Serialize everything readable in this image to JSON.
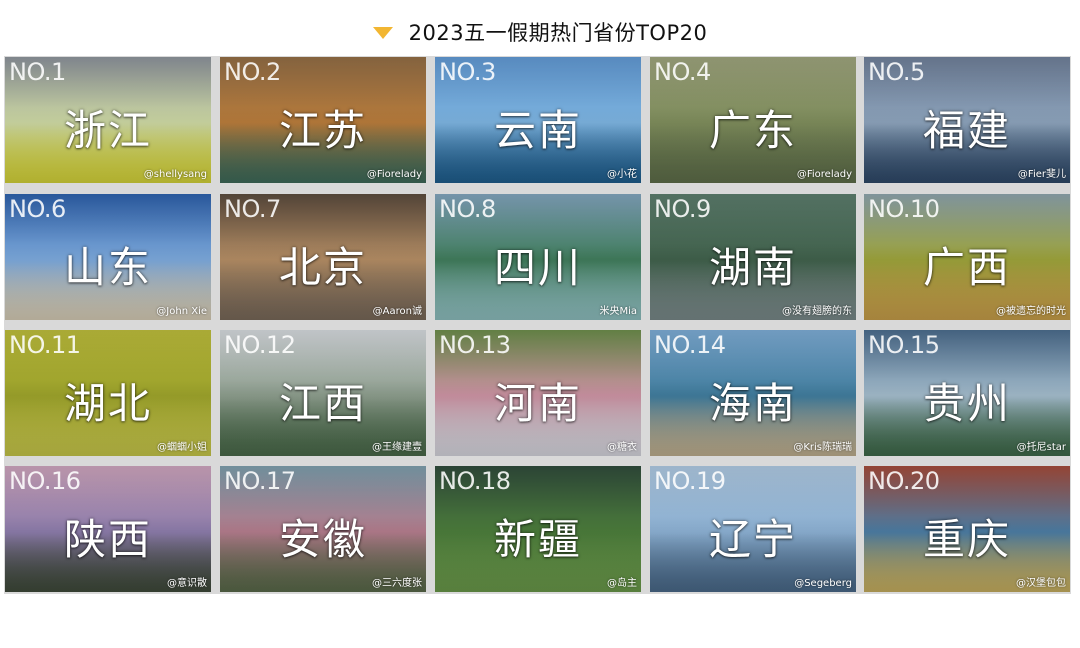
{
  "header": {
    "title": "2023五一假期热门省份TOP20",
    "accent": "#f2b632"
  },
  "tiles": [
    {
      "rank": "NO.1",
      "name": "浙江",
      "credit": "@shellysang",
      "colors": [
        "#8a9098",
        "#c9d4a0",
        "#d7d63a"
      ]
    },
    {
      "rank": "NO.2",
      "name": "江苏",
      "credit": "@Fiorelady",
      "colors": [
        "#8f6b44",
        "#b4793a",
        "#3f6b5a"
      ]
    },
    {
      "rank": "NO.3",
      "name": "云南",
      "credit": "@小花",
      "colors": [
        "#5f96cf",
        "#7ab0dc",
        "#1f5f8f"
      ]
    },
    {
      "rank": "NO.4",
      "name": "广东",
      "credit": "@Fiorelady",
      "colors": [
        "#9aa07a",
        "#7c8a5a",
        "#5f6f4a"
      ]
    },
    {
      "rank": "NO.5",
      "name": "福建",
      "credit": "@Fier斐儿",
      "colors": [
        "#6d7d96",
        "#8aa0b8",
        "#2f4a6a"
      ]
    },
    {
      "rank": "NO.6",
      "name": "山东",
      "credit": "@John Xie",
      "colors": [
        "#2d5fa8",
        "#7aa6d8",
        "#d9cfb8"
      ]
    },
    {
      "rank": "NO.7",
      "name": "北京",
      "credit": "@Aaron诚",
      "colors": [
        "#5a4a3c",
        "#b08a62",
        "#7a6a5a"
      ]
    },
    {
      "rank": "NO.8",
      "name": "四川",
      "credit": "米央Mia",
      "colors": [
        "#7ea0b8",
        "#3f7a5a",
        "#8fc0c0"
      ]
    },
    {
      "rank": "NO.9",
      "name": "湖南",
      "credit": "@没有翅膀的东",
      "colors": [
        "#5a7a6a",
        "#3f5f4a",
        "#7a8a8a"
      ]
    },
    {
      "rank": "NO.10",
      "name": "广西",
      "credit": "@被遗忘的时光",
      "colors": [
        "#8aa0a8",
        "#9aa03a",
        "#c9a04a"
      ]
    },
    {
      "rank": "NO.11",
      "name": "湖北",
      "credit": "@蝈蝈小姐",
      "colors": [
        "#b8b83a",
        "#9aa02a",
        "#c8c84a"
      ]
    },
    {
      "rank": "NO.12",
      "name": "江西",
      "credit": "@王缘建壹",
      "colors": [
        "#d0d4d8",
        "#8a9a8a",
        "#4a6a4a"
      ]
    },
    {
      "rank": "NO.13",
      "name": "河南",
      "credit": "@糖衣",
      "colors": [
        "#6a8a4a",
        "#c890a0",
        "#d8d8e0"
      ]
    },
    {
      "rank": "NO.14",
      "name": "海南",
      "credit": "@Kris陈瑞瑞",
      "colors": [
        "#7aa8d0",
        "#3f7a9a",
        "#c0b090"
      ]
    },
    {
      "rank": "NO.15",
      "name": "贵州",
      "credit": "@托尼star",
      "colors": [
        "#4a6a8a",
        "#a0b8c8",
        "#3f6a4a"
      ]
    },
    {
      "rank": "NO.16",
      "name": "陕西",
      "credit": "@意识散",
      "colors": [
        "#c8a0b8",
        "#8a7aa8",
        "#3f4a3a"
      ]
    },
    {
      "rank": "NO.17",
      "name": "安徽",
      "credit": "@三六度张",
      "colors": [
        "#7a9aa8",
        "#b07a8a",
        "#5a6a4a"
      ]
    },
    {
      "rank": "NO.18",
      "name": "新疆",
      "credit": "@岛主",
      "colors": [
        "#2f4a3a",
        "#4a7a3a",
        "#6a9a4a"
      ]
    },
    {
      "rank": "NO.19",
      "name": "辽宁",
      "credit": "@Segeberg",
      "colors": [
        "#aac4dc",
        "#8aaed0",
        "#4a6a8a"
      ]
    },
    {
      "rank": "NO.20",
      "name": "重庆",
      "credit": "@汉堡包包",
      "colors": [
        "#a04a3a",
        "#4a7aa0",
        "#c8b060"
      ]
    }
  ]
}
